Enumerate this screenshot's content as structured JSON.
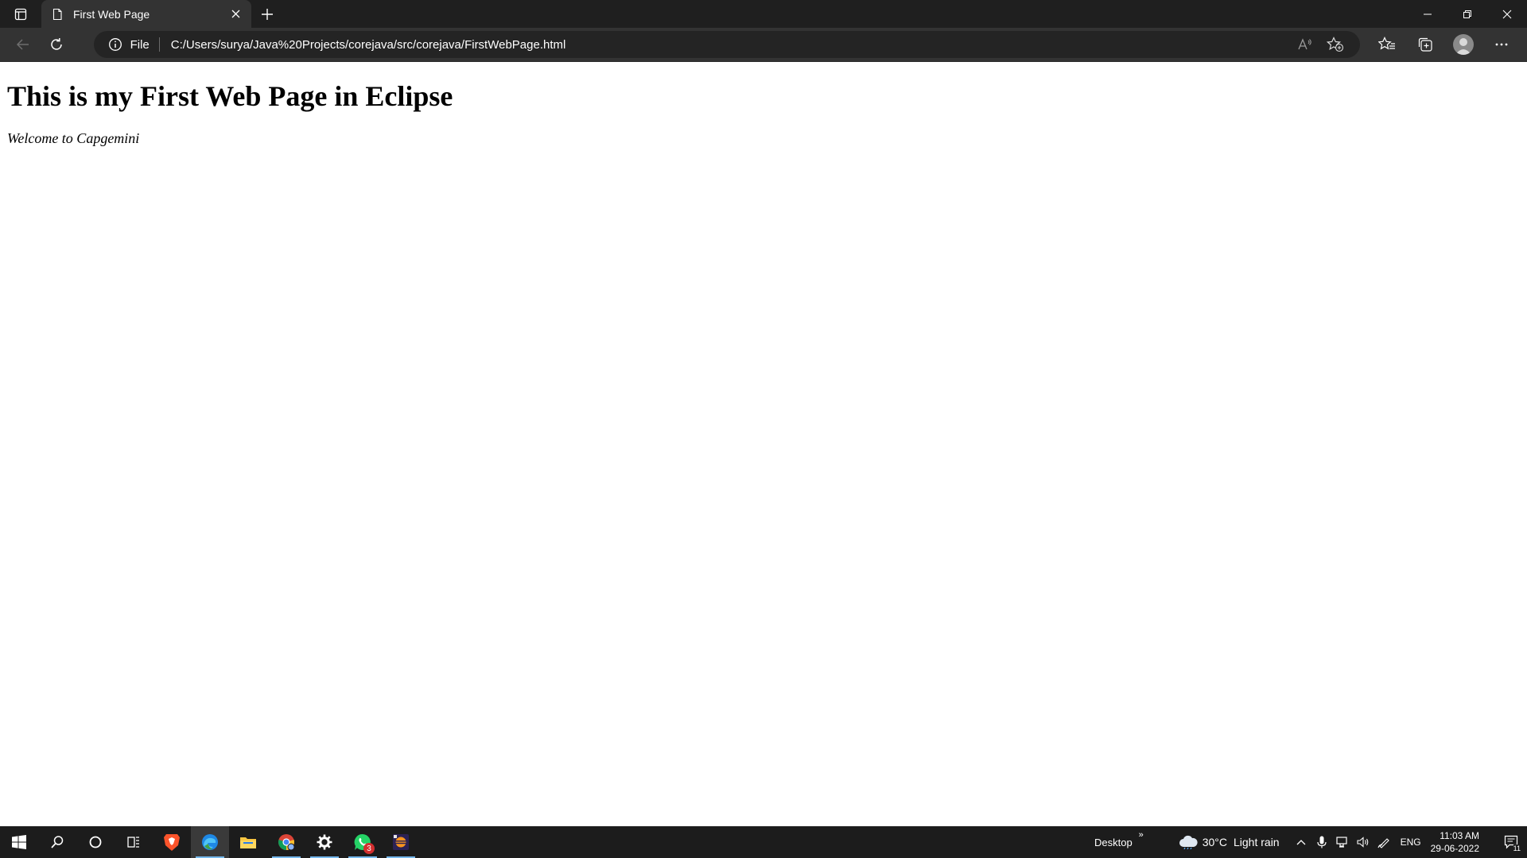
{
  "browser": {
    "tab": {
      "title": "First Web Page"
    },
    "address_bar": {
      "scheme_label": "File",
      "url": "C:/Users/surya/Java%20Projects/corejava/src/corejava/FirstWebPage.html"
    }
  },
  "page": {
    "heading": "This is my First Web Page in Eclipse",
    "paragraph": "Welcome to Capgemini"
  },
  "taskbar": {
    "apps": [
      "windows-start",
      "search",
      "cortana",
      "task-view",
      "brave",
      "edge",
      "file-explorer",
      "chrome",
      "settings",
      "whatsapp",
      "eclipse"
    ],
    "whatsapp_badge": "3",
    "toolbar_label": "Desktop",
    "toolbar_chevron": "»",
    "weather": {
      "temperature": "30°C",
      "condition": "Light rain"
    },
    "language": "ENG",
    "time": "11:03 AM",
    "date": "29-06-2022",
    "notification_count": "11"
  },
  "colors": {
    "titlebar_bg": "#1f1f1f",
    "toolbar_bg": "#333333",
    "omnibox_bg": "#242424",
    "taskbar_bg": "#1c1c1c",
    "accent": "#76b9ed"
  }
}
